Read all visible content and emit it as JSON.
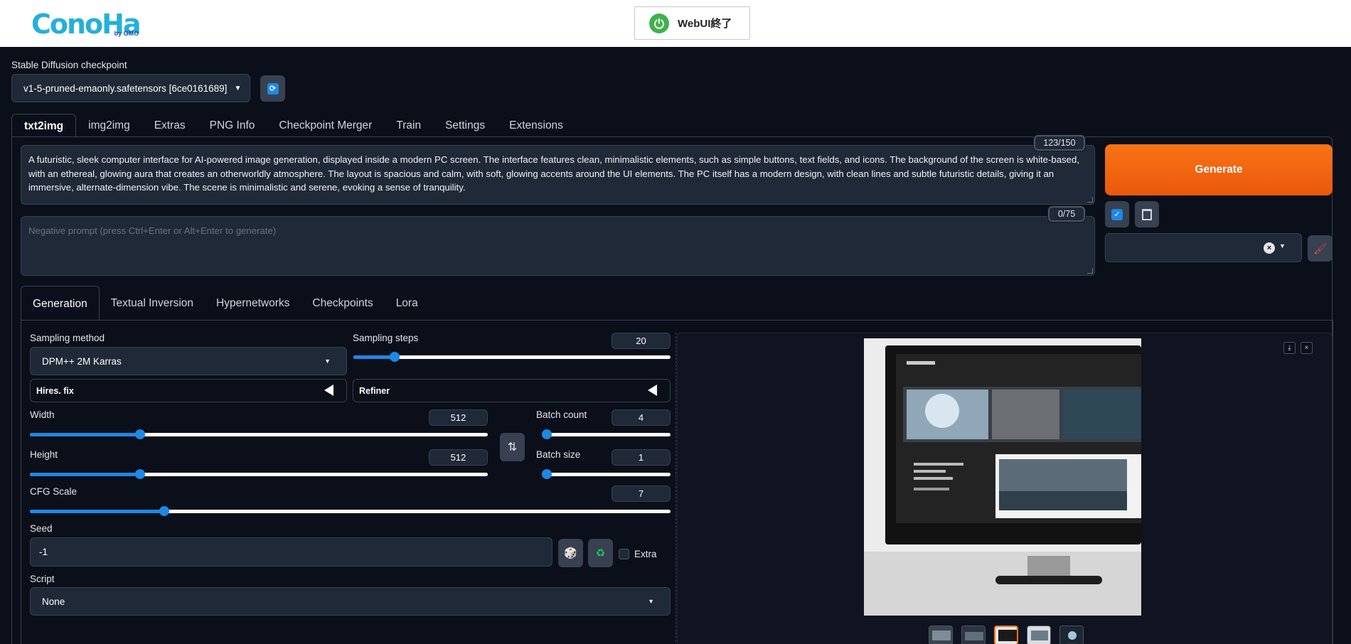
{
  "header": {
    "logo_text": "ConoHa",
    "logo_sub": "by GMO",
    "exit_button": "WebUI終了"
  },
  "checkpoint": {
    "label": "Stable Diffusion checkpoint",
    "value": "v1-5-pruned-emaonly.safetensors [6ce0161689]"
  },
  "main_tabs": [
    "txt2img",
    "img2img",
    "Extras",
    "PNG Info",
    "Checkpoint Merger",
    "Train",
    "Settings",
    "Extensions"
  ],
  "prompt": {
    "value": "A futuristic, sleek computer interface for AI-powered image generation, displayed inside a modern PC screen. The interface features clean, minimalistic elements, such as simple buttons, text fields, and icons. The background of the screen is white-based, with an ethereal, glowing aura that creates an otherworldly atmosphere. The layout is spacious and calm, with soft, glowing accents around the UI elements. The PC itself has a modern design, with clean lines and subtle futuristic details, giving it an immersive, alternate-dimension vibe. The scene is minimalistic and serene, evoking a sense of tranquility.",
    "token_count": "123/150"
  },
  "negative_prompt": {
    "placeholder": "Negative prompt (press Ctrl+Enter or Alt+Enter to generate)",
    "token_count": "0/75"
  },
  "generate_label": "Generate",
  "sub_tabs": [
    "Generation",
    "Textual Inversion",
    "Hypernetworks",
    "Checkpoints",
    "Lora"
  ],
  "sampling": {
    "method_label": "Sampling method",
    "method_value": "DPM++ 2M Karras",
    "steps_label": "Sampling steps",
    "steps_value": "20",
    "steps_fraction": 0.13
  },
  "hires_label": "Hires. fix",
  "refiner_label": "Refiner",
  "width": {
    "label": "Width",
    "value": "512",
    "fraction": 0.24
  },
  "height": {
    "label": "Height",
    "value": "512",
    "fraction": 0.24
  },
  "batch_count": {
    "label": "Batch count",
    "value": "4",
    "fraction": 0.03
  },
  "batch_size": {
    "label": "Batch size",
    "value": "1",
    "fraction": 0.0
  },
  "cfg": {
    "label": "CFG Scale",
    "value": "7",
    "fraction": 0.21
  },
  "seed": {
    "label": "Seed",
    "value": "-1",
    "extra_label": "Extra"
  },
  "script": {
    "label": "Script",
    "value": "None"
  },
  "colors": {
    "accent": "#1e88e5",
    "generate": "#f97316",
    "background": "#0b0f19"
  }
}
